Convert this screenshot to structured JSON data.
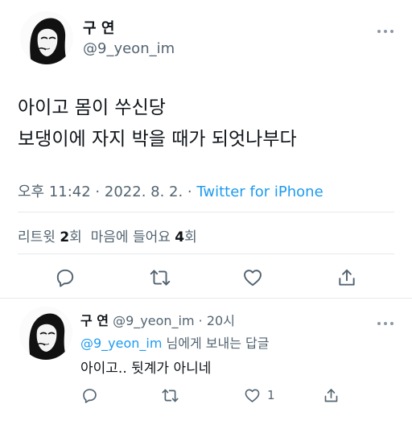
{
  "tweet": {
    "display_name": "구 연",
    "handle": "@9_yeon_im",
    "lines": [
      "아이고 몸이 쑤신당",
      "보댕이에 자지 박을 때가 되엇나부다"
    ],
    "timestamp": "오후 11:42 · 2022. 8. 2. · ",
    "source": "Twitter for iPhone",
    "stats": {
      "retweet_label": "리트윗 ",
      "retweet_count": "2",
      "retweet_unit": "회",
      "like_label": "마음에 들어요 ",
      "like_count": "4",
      "like_unit": "회"
    }
  },
  "reply": {
    "display_name": "구 연",
    "handle": "@9_yeon_im",
    "time_sep": " · ",
    "time": "20시",
    "reply_to_mention": "@9_yeon_im",
    "reply_to_suffix": " 님에게 보내는 답글",
    "text": "아이고.. 뒷계가 아니네",
    "like_count": "1"
  },
  "icons": {
    "more": "more-horizontal-icon",
    "reply": "reply-icon",
    "retweet": "retweet-icon",
    "like": "heart-icon",
    "share": "share-icon"
  },
  "colors": {
    "link": "#1d9bf0",
    "secondary_text": "#536471",
    "text": "#0f1419"
  }
}
